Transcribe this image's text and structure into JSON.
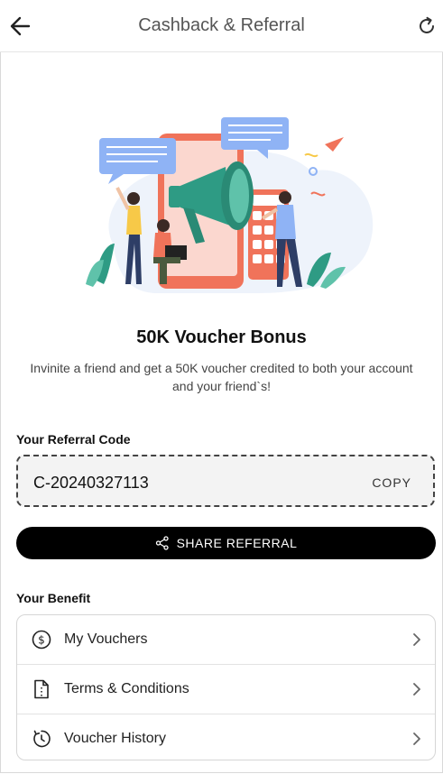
{
  "header": {
    "title": "Cashback & Referral"
  },
  "bonus": {
    "title": "50K Voucher Bonus",
    "description": "Invinite a friend and get a 50K voucher credited to both your account and your friend`s!"
  },
  "referral": {
    "label": "Your Referral Code",
    "code": "C-20240327113",
    "copy_label": "COPY",
    "share_label": "SHARE REFERRAL"
  },
  "benefit": {
    "label": "Your Benefit",
    "items": [
      {
        "label": "My Vouchers",
        "icon": "dollar-circle-icon"
      },
      {
        "label": "Terms & Conditions",
        "icon": "document-icon"
      },
      {
        "label": "Voucher History",
        "icon": "history-clock-icon"
      }
    ]
  },
  "colors": {
    "accent": "#000000",
    "illustration_teal": "#2e9b84",
    "illustration_red": "#f0735a",
    "illustration_blue": "#8fb3f5"
  }
}
